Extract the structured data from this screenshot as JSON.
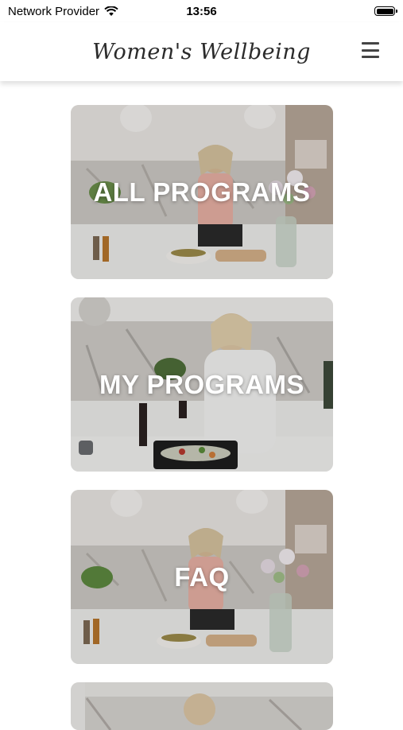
{
  "status_bar": {
    "carrier": "Network Provider",
    "time": "13:56"
  },
  "header": {
    "logo_text": "Women's Wellbeing",
    "menu_icon": "hamburger-menu-icon"
  },
  "cards": [
    {
      "label": "ALL PROGRAMS"
    },
    {
      "label": "MY PROGRAMS"
    },
    {
      "label": "FAQ"
    },
    {
      "label": ""
    }
  ],
  "colors": {
    "header_bg": "#ffffff",
    "card_text": "#ffffff",
    "logo_color": "#2b2b2b"
  }
}
